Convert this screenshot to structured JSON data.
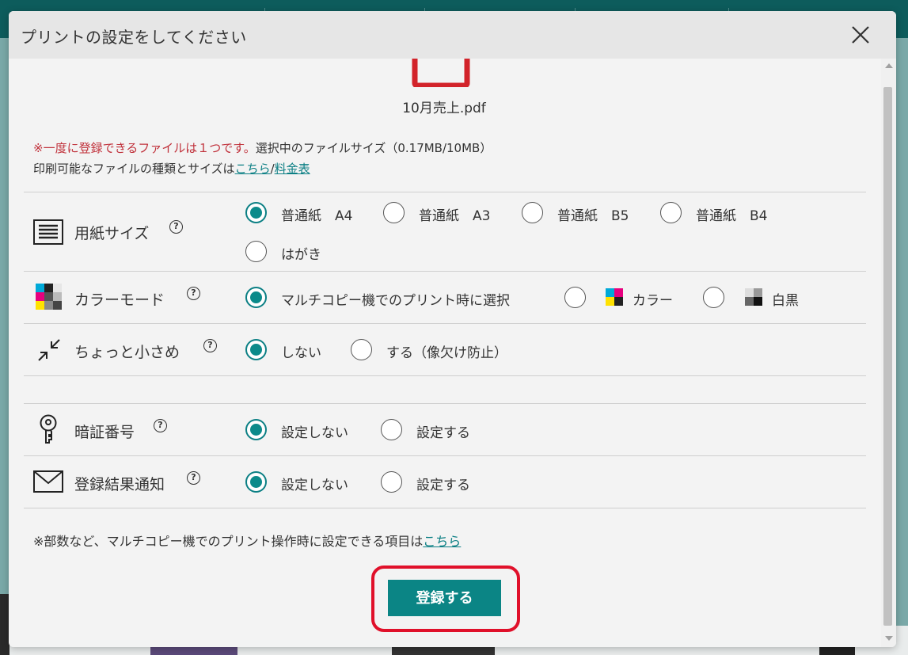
{
  "dialog": {
    "title": "プリントの設定をしてください",
    "file_name": "10月売上.pdf"
  },
  "notice": {
    "warning": "※一度に登録できるファイルは１つです。",
    "size_info": "選択中のファイルサイズ（0.17MB/10MB）",
    "types_prefix": "印刷可能なファイルの種類とサイズは",
    "types_link": "こちら",
    "slash": "/",
    "fee_link": "料金表"
  },
  "paper_size": {
    "label": "用紙サイズ",
    "help": "?",
    "options": [
      "普通紙　A4",
      "普通紙　A3",
      "普通紙　B5",
      "普通紙　B4",
      "はがき"
    ],
    "selected_index": 0
  },
  "color_mode": {
    "label": "カラーモード",
    "help": "?",
    "options": [
      "マルチコピー機でのプリント時に選択",
      "カラー",
      "白黒"
    ],
    "selected_index": 0
  },
  "shrink": {
    "label": "ちょっと小さめ",
    "help": "?",
    "options": [
      "しない",
      "する（像欠け防止）"
    ],
    "selected_index": 0
  },
  "pin": {
    "label": "暗証番号",
    "help": "?",
    "options": [
      "設定しない",
      "設定する"
    ],
    "selected_index": 0
  },
  "notify": {
    "label": "登録結果通知",
    "help": "?",
    "options": [
      "設定しない",
      "設定する"
    ],
    "selected_index": 0
  },
  "footer": {
    "note": "※部数など、マルチコピー機でのプリント操作時に設定できる項目は",
    "link": "こちら"
  },
  "submit_label": "登録する",
  "colors": {
    "accent": "#0b8585",
    "warning": "#c0303a",
    "highlight": "#e0102a",
    "pdf_icon": "#d2232a"
  }
}
